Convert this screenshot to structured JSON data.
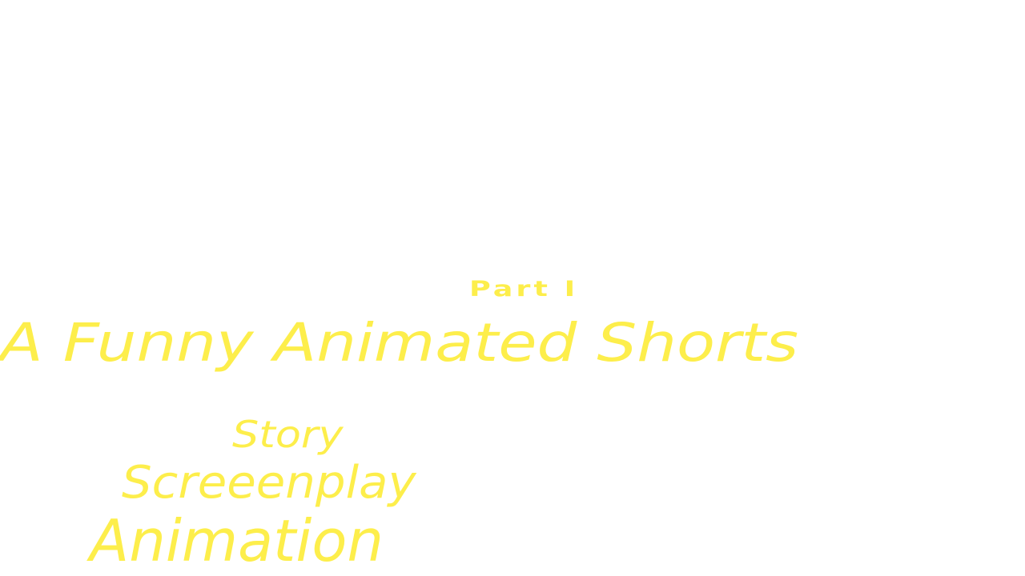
{
  "accent_color": "#fdee4b",
  "title_card": {
    "part": "Part I",
    "title": "A Funny Animated Shorts"
  },
  "credits": {
    "items": [
      "Story",
      "Screeenplay",
      "Animation"
    ]
  }
}
